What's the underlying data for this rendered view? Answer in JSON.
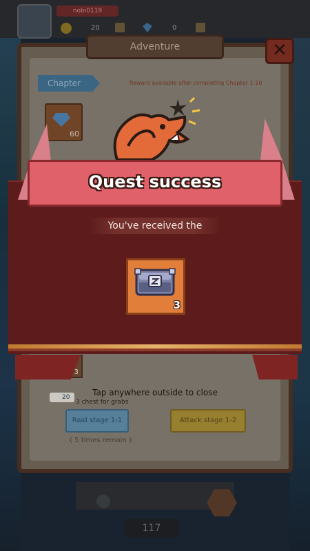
{
  "topbar": {
    "player_name": "nobi0119",
    "coins": "20",
    "gems": "0"
  },
  "adventure": {
    "title": "Adventure",
    "close_label": "✕",
    "chapter_tab": "Chapter",
    "reward_note": "Reward available after completing Chapter 1-10",
    "gem_reward_count": "60",
    "chest_count": "3",
    "raid_cost": "20",
    "chest_grabs": "3 chest for grabs",
    "raid_button": "Raid stage 1-1",
    "attack_button": "Attack stage 1-2",
    "remaining": "( 5 times remain )"
  },
  "popup": {
    "title": "Quest success",
    "received_text": "You've received the",
    "reward_quantity": "3",
    "reward_icon": "chest-icon",
    "close_hint": "Tap anywhere outside to close"
  },
  "bottom": {
    "page_number": "117"
  },
  "colors": {
    "banner": "#e0616a",
    "popup_band": "#5d1c1b",
    "reward_card": "#e07e3a",
    "accent_gold": "#e7b36a"
  }
}
